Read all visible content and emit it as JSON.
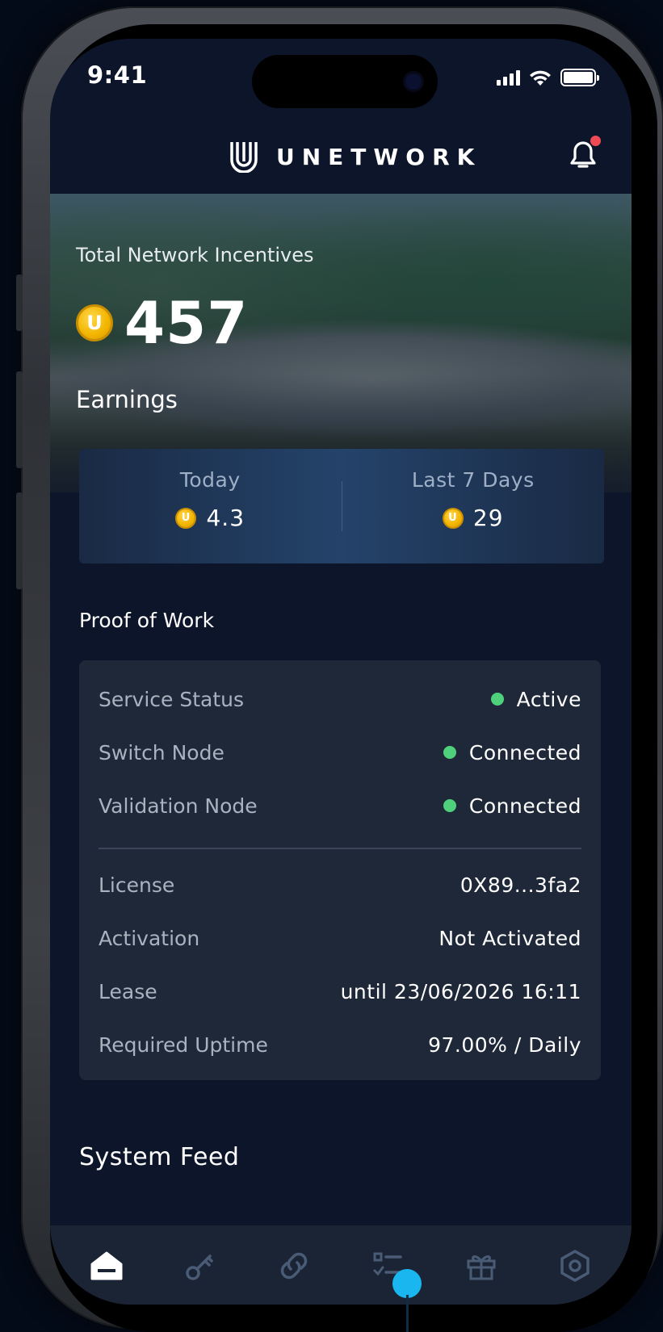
{
  "status_bar": {
    "time": "9:41"
  },
  "header": {
    "brand": "UNETWORK",
    "notification_dot": true
  },
  "hero": {
    "label": "Total Network Incentives",
    "value": "457",
    "coin_symbol": "U"
  },
  "earnings": {
    "title": "Earnings",
    "today_label": "Today",
    "today_value": "4.3",
    "week_label": "Last 7 Days",
    "week_value": "29"
  },
  "proof_of_work": {
    "title": "Proof of Work",
    "status_rows": [
      {
        "label": "Service Status",
        "value": "Active"
      },
      {
        "label": "Switch Node",
        "value": "Connected"
      },
      {
        "label": "Validation Node",
        "value": "Connected"
      }
    ],
    "info_rows": [
      {
        "label": "License",
        "value": "0X89...3fa2"
      },
      {
        "label": "Activation",
        "value": "Not Activated"
      },
      {
        "label": "Lease",
        "value": "until 23/06/2026 16:11"
      },
      {
        "label": "Required Uptime",
        "value": "97.00% / Daily"
      }
    ]
  },
  "system_feed": {
    "title": "System Feed"
  },
  "tabbar": {
    "items": [
      "home-icon",
      "key-icon",
      "link-icon",
      "tasks-icon",
      "gift-icon",
      "settings-icon"
    ],
    "active": "home-icon"
  },
  "colors": {
    "background": "#0d152a",
    "card": "#1e2838",
    "status_ok": "#4fd17c",
    "coin": "#f2b400",
    "notification": "#ef4b56",
    "accent": "#19b6f0"
  }
}
